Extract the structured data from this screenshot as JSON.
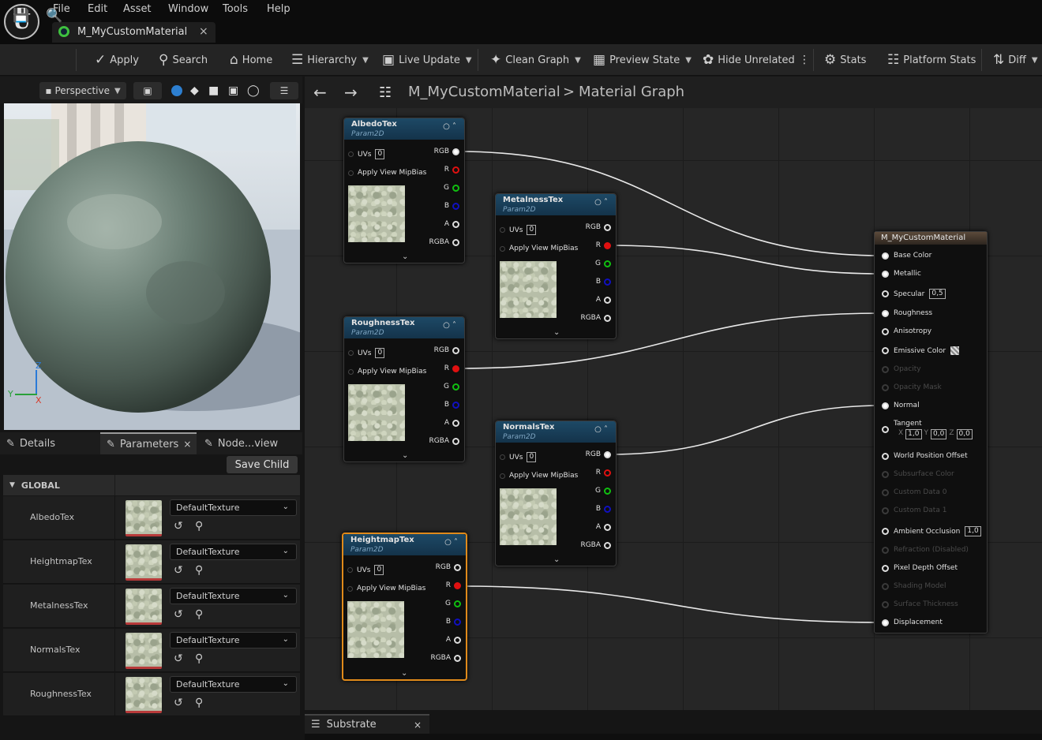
{
  "menubar": {
    "items": [
      "File",
      "Edit",
      "Asset",
      "Window",
      "Tools",
      "Help"
    ],
    "doc_tab": "M_MyCustomMaterial",
    "close": "×"
  },
  "toolbar": {
    "apply": "Apply",
    "search": "Search",
    "home": "Home",
    "hierarchy": "Hierarchy",
    "live_update": "Live Update",
    "clean_graph": "Clean Graph",
    "preview_state": "Preview State",
    "hide_unrelated": "Hide Unrelated",
    "stats": "Stats",
    "platform_stats": "Platform Stats",
    "diff": "Diff"
  },
  "viewport": {
    "mode": "Perspective",
    "axis_z": "Z",
    "axis_y": "Y",
    "axis_x": "X"
  },
  "left_tabs": {
    "details": "Details",
    "parameters": "Parameters",
    "node_view": "Node...view",
    "close": "×"
  },
  "params": {
    "save_child": "Save Child",
    "group": "GLOBAL",
    "rows": [
      {
        "name": "AlbedoTex",
        "value": "DefaultTexture"
      },
      {
        "name": "HeightmapTex",
        "value": "DefaultTexture"
      },
      {
        "name": "MetalnessTex",
        "value": "DefaultTexture"
      },
      {
        "name": "NormalsTex",
        "value": "DefaultTexture"
      },
      {
        "name": "RoughnessTex",
        "value": "DefaultTexture"
      }
    ]
  },
  "graph": {
    "breadcrumb_asset": "M_MyCustomMaterial",
    "breadcrumb_sep": ">",
    "breadcrumb_graph": "Material Graph",
    "param_type": "Param2D",
    "in_uvs": "UVs",
    "in_uvs_val": "0",
    "in_mip": "Apply View MipBias",
    "outputs": [
      "RGB",
      "R",
      "G",
      "B",
      "A",
      "RGBA"
    ],
    "nodes": {
      "albedo": "AlbedoTex",
      "metalness": "MetalnessTex",
      "roughness": "RoughnessTex",
      "normals": "NormalsTex",
      "heightmap": "HeightmapTex"
    },
    "material": {
      "title": "M_MyCustomMaterial",
      "pins": {
        "base_color": "Base Color",
        "metallic": "Metallic",
        "specular": "Specular",
        "specular_val": "0,5",
        "roughness": "Roughness",
        "anisotropy": "Anisotropy",
        "emissive": "Emissive Color",
        "opacity": "Opacity",
        "opacity_mask": "Opacity Mask",
        "normal": "Normal",
        "tangent": "Tangent",
        "tan_x_label": "X",
        "tan_x": "1,0",
        "tan_y_label": "Y",
        "tan_y": "0,0",
        "tan_z_label": "Z",
        "tan_z": "0,0",
        "wpo": "World Position Offset",
        "subsurface": "Subsurface Color",
        "custom0": "Custom Data 0",
        "custom1": "Custom Data 1",
        "ao": "Ambient Occlusion",
        "ao_val": "1,0",
        "refraction": "Refraction (Disabled)",
        "pdo": "Pixel Depth Offset",
        "shading": "Shading Model",
        "surface_thickness": "Surface Thickness",
        "displacement": "Displacement"
      }
    }
  },
  "bottom_tab": {
    "label": "Substrate",
    "close": "×"
  },
  "colors": {
    "accent_selection": "#e08a1a",
    "node_header": "#1d4966",
    "pin_red": "#e01010",
    "pin_green": "#10c010",
    "pin_blue": "#1010c0"
  }
}
